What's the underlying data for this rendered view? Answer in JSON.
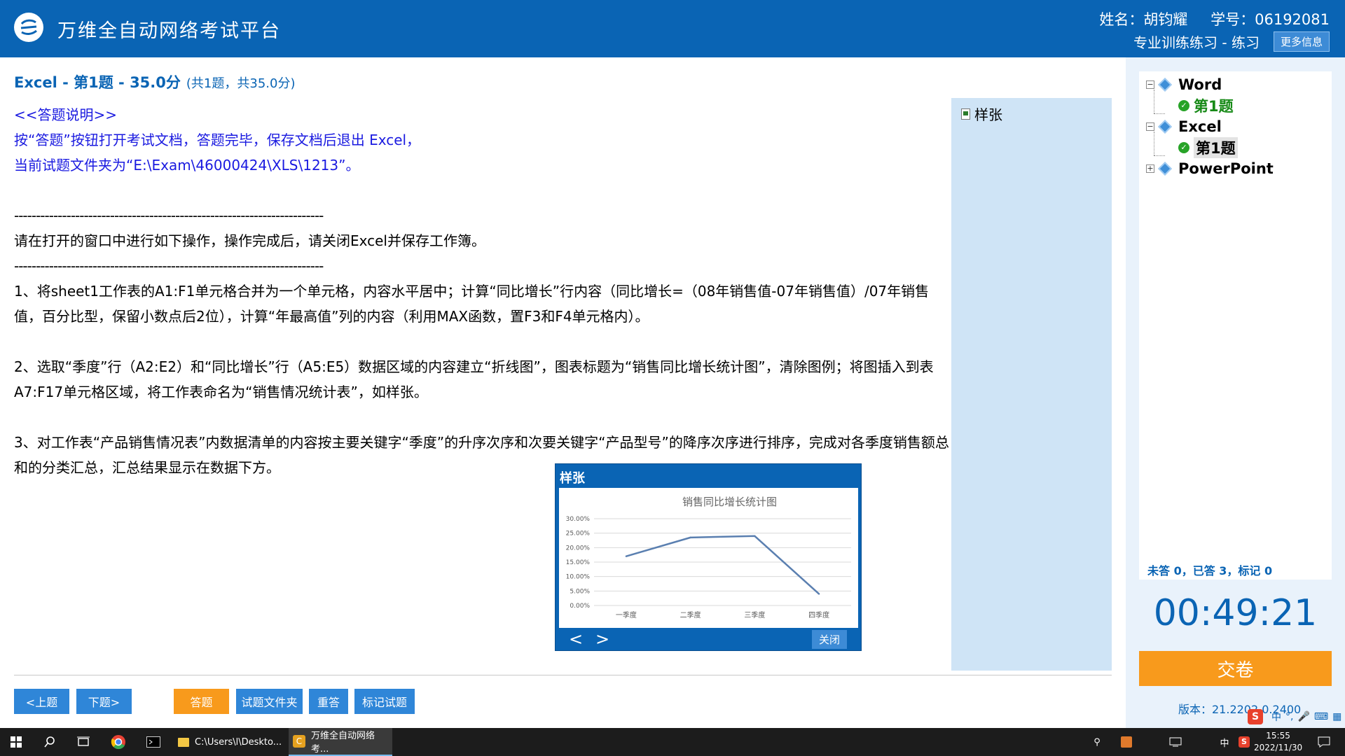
{
  "header": {
    "app_title": "万维全自动网络考试平台",
    "name_label": "姓名：胡钧耀",
    "id_label": "学号：06192081",
    "mode_label": "专业训练练习 - 练习",
    "more_info": "更多信息"
  },
  "question": {
    "title": "Excel - 第1题 - 35.0分",
    "subtitle": "(共1题，共35.0分)",
    "lines": {
      "l1": "<<答题说明>>",
      "l2": "按“答题”按钮打开考试文档，答题完毕，保存文档后退出 Excel，",
      "l3": "当前试题文件夹为“E:\\Exam\\46000424\\XLS\\1213”。",
      "dash": "-----------------------------------------------------------------------",
      "instruction": " 请在打开的窗口中进行如下操作，操作完成后，请关闭Excel并保存工作簿。",
      "step1": "1、将sheet1工作表的A1:F1单元格合并为一个单元格，内容水平居中；计算“同比增长”行内容（同比增长=（08年销售值-07年销售值）/07年销售值，百分比型，保留小数点后2位），计算“年最高值”列的内容（利用MAX函数，置F3和F4单元格内）。",
      "step2": "2、选取“季度”行（A2:E2）和“同比增长”行（A5:E5）数据区域的内容建立“折线图”，图表标题为“销售同比增长统计图”，清除图例；将图插入到表A7:F17单元格区域，将工作表命名为“销售情况统计表”，如样张。",
      "step3": "3、对工作表“产品销售情况表”内数据清单的内容按主要关键字“季度”的升序次序和次要关键字“产品型号”的降序次序进行排序，完成对各季度销售额总和的分类汇总，汇总结果显示在数据下方。"
    },
    "sample_tag": "样张"
  },
  "popup": {
    "title": "样张",
    "prev": "<",
    "next": ">",
    "close": "关闭"
  },
  "chart_data": {
    "type": "line",
    "title": "销售同比增长统计图",
    "categories": [
      "一季度",
      "二季度",
      "三季度",
      "四季度"
    ],
    "values": [
      0.17,
      0.235,
      0.24,
      0.04
    ],
    "ylim": [
      0,
      0.3
    ],
    "y_ticks": [
      "0.00%",
      "5.00%",
      "10.00%",
      "15.00%",
      "20.00%",
      "25.00%",
      "30.00%"
    ],
    "legend": false,
    "grid": true,
    "line_color": "#5a7fb0"
  },
  "buttons": {
    "prev": "<上题",
    "next": "下题>",
    "answer": "答题",
    "folder": "试题文件夹",
    "redo": "重答",
    "mark": "标记试题"
  },
  "tree": {
    "word": "Word",
    "word_q1": "第1题",
    "excel": "Excel",
    "excel_q1": "第1题",
    "ppt": "PowerPoint",
    "status": "未答 0，已答 3，标记 0"
  },
  "timer": "00:49:21",
  "submit": "交卷",
  "version": "版本：21.2202.0.2400",
  "ime": {
    "lang": "中",
    "punct": "°,"
  },
  "taskbar": {
    "explorer": "C:\\Users\\l\\Deskto...",
    "exam_app": "万维全自动网络考...",
    "ime_lang": "中",
    "time": "15:55",
    "date": "2022/11/30"
  }
}
